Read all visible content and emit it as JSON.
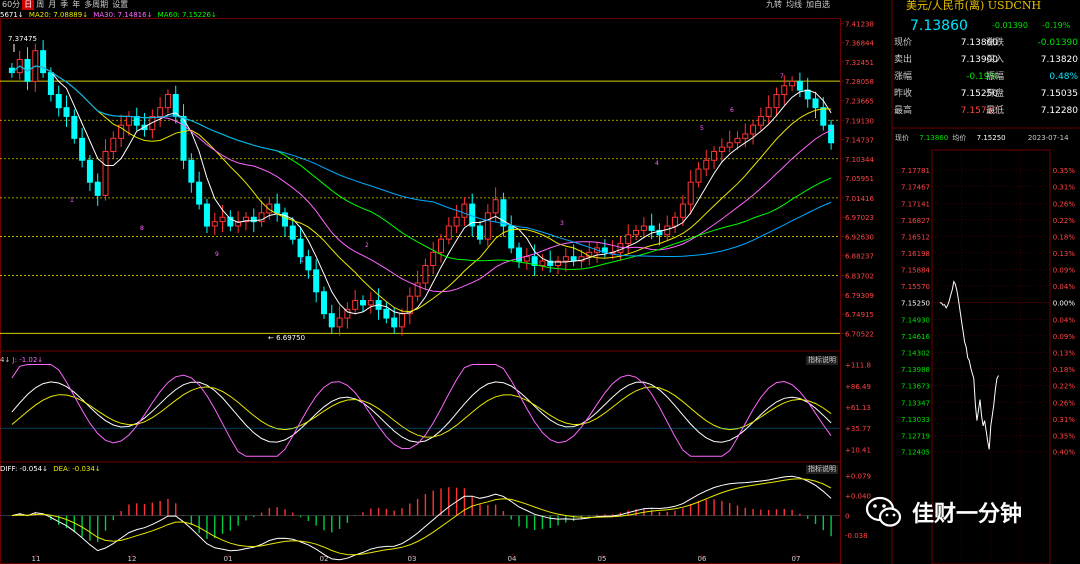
{
  "toolbar": {
    "tabs": [
      "60分",
      "日",
      "周",
      "月",
      "季",
      "年",
      "多周期",
      "设置"
    ],
    "active_tab": 1,
    "right_buttons": [
      "九转",
      "均线",
      "加自选"
    ]
  },
  "ma_legend": {
    "ma5": "5671↓",
    "ma20": "MA20: 7.08889↓",
    "ma30": "MA30: 7.14816↓",
    "ma60": "MA60: 7.15226↓"
  },
  "kdj_legend": {
    "text": "J: -1.02↓"
  },
  "macd_legend": {
    "diff": "DIFF: -0.054↓",
    "dea": "DEA: -0.034↓"
  },
  "indicator_button": "指标说明",
  "quote": {
    "title": "美元/人民币(离) USDCNH",
    "price": "7.13860",
    "change": "-0.01390",
    "change_pct": "-0.19%",
    "rows": [
      {
        "l1": "现价",
        "v1": "7.13860",
        "l2": "涨跌",
        "v2": "-0.01390"
      },
      {
        "l1": "卖出",
        "v1": "7.13900",
        "l2": "买入",
        "v2": "7.13820"
      },
      {
        "l1": "涨幅",
        "v1": "-0.19%",
        "l2": "振幅",
        "v2": "0.48%"
      },
      {
        "l1": "昨收",
        "v1": "7.15250",
        "l2": "开盘",
        "v2": "7.15035"
      },
      {
        "l1": "最高",
        "v1": "7.15730",
        "l2": "最低",
        "v2": "7.12280"
      }
    ],
    "intraday_header": {
      "label": "现价",
      "price": "7.13860",
      "avg_label": "均价",
      "avg": "7.15250",
      "date": "2023-07-14"
    }
  },
  "chart_data": [
    {
      "type": "candlestick",
      "ylim": [
        6.69,
        7.42
      ],
      "y_ticks": [
        "7.41238",
        "7.36844",
        "7.32451",
        "7.28058",
        "7.23665",
        "7.19130",
        "7.14737",
        "7.10344",
        "7.05951",
        "7.01416",
        "6.97023",
        "6.92630",
        "6.88237",
        "6.83702",
        "6.79309",
        "6.74915",
        "6.70522"
      ],
      "x_ticks": [
        "11",
        "12",
        "01",
        "02",
        "03",
        "04",
        "05",
        "06",
        "07"
      ],
      "annotations": {
        "high": "7.37475",
        "low": "6.69750"
      },
      "reference_levels": [
        7.2806,
        7.1913,
        7.1034,
        7.0142,
        6.9263,
        6.837,
        6.7052
      ],
      "close": [
        7.3,
        7.33,
        7.28,
        7.35,
        7.3,
        7.25,
        7.22,
        7.2,
        7.15,
        7.1,
        7.05,
        7.02,
        7.12,
        7.15,
        7.18,
        7.2,
        7.18,
        7.17,
        7.2,
        7.22,
        7.25,
        7.2,
        7.1,
        7.05,
        7.0,
        6.95,
        6.96,
        6.97,
        6.95,
        6.96,
        6.97,
        6.96,
        6.98,
        7.0,
        6.98,
        6.95,
        6.92,
        6.88,
        6.85,
        6.8,
        6.75,
        6.72,
        6.74,
        6.76,
        6.78,
        6.77,
        6.78,
        6.76,
        6.74,
        6.72,
        6.75,
        6.79,
        6.82,
        6.86,
        6.89,
        6.92,
        6.95,
        6.97,
        7.0,
        6.95,
        6.92,
        6.98,
        7.01,
        6.95,
        6.9,
        6.87,
        6.88,
        6.86,
        6.87,
        6.86,
        6.87,
        6.88,
        6.87,
        6.88,
        6.89,
        6.9,
        6.89,
        6.89,
        6.91,
        6.93,
        6.94,
        6.95,
        6.94,
        6.93,
        6.95,
        6.97,
        7.0,
        7.05,
        7.08,
        7.1,
        7.12,
        7.13,
        7.14,
        7.15,
        7.16,
        7.18,
        7.2,
        7.22,
        7.25,
        7.27,
        7.28,
        7.26,
        7.24,
        7.22,
        7.18,
        7.14
      ],
      "ma_colors": {
        "ma5": "#ffffff",
        "ma20": "#e8e800",
        "ma30": "#ff66ff",
        "ma60": "#00ff00",
        "ma120": "#00aaff"
      }
    },
    {
      "type": "line",
      "name": "KDJ",
      "y_ticks": [
        "111.8",
        "86.49",
        "61.13",
        "35.77",
        "10.41"
      ],
      "ylim": [
        0,
        115
      ]
    },
    {
      "type": "bar",
      "name": "MACD",
      "y_ticks": [
        "0.079",
        "0.040",
        "0",
        "-0.038"
      ],
      "ylim": [
        -0.06,
        0.09
      ]
    },
    {
      "type": "line",
      "name": "intraday",
      "y_ticks": [
        "7.17781",
        "7.17467",
        "7.17141",
        "7.16827",
        "7.16512",
        "7.16198",
        "7.15884",
        "7.15570",
        "7.15250",
        "7.14930",
        "7.14616",
        "7.14302",
        "7.13988",
        "7.13673",
        "7.13347",
        "7.13033",
        "7.12719",
        "7.12405"
      ],
      "pct_ticks": [
        "0.35%",
        "0.31%",
        "0.26%",
        "0.22%",
        "0.18%",
        "0.13%",
        "0.09%",
        "0.04%",
        "0.00%",
        "0.04%",
        "0.09%",
        "0.13%",
        "0.18%",
        "0.22%",
        "0.26%",
        "0.31%",
        "0.35%",
        "0.40%"
      ],
      "ylim": [
        7.124,
        7.1778
      ],
      "prev_close": 7.1525,
      "values": [
        7.1525,
        7.1524,
        7.152,
        7.1521,
        7.1515,
        7.152,
        7.1528,
        7.154,
        7.155,
        7.1565,
        7.156,
        7.1548,
        7.153,
        7.151,
        7.149,
        7.147,
        7.145,
        7.144,
        7.142,
        7.1415,
        7.14,
        7.139,
        7.138,
        7.133,
        7.13,
        7.132,
        7.134,
        7.131,
        7.129,
        7.13,
        7.128,
        7.126,
        7.1245,
        7.129,
        7.131,
        7.133,
        7.136,
        7.138,
        7.1386
      ]
    }
  ],
  "watermark": {
    "text": "佳财一分钟",
    "logo": "wechat-logo-icon"
  }
}
